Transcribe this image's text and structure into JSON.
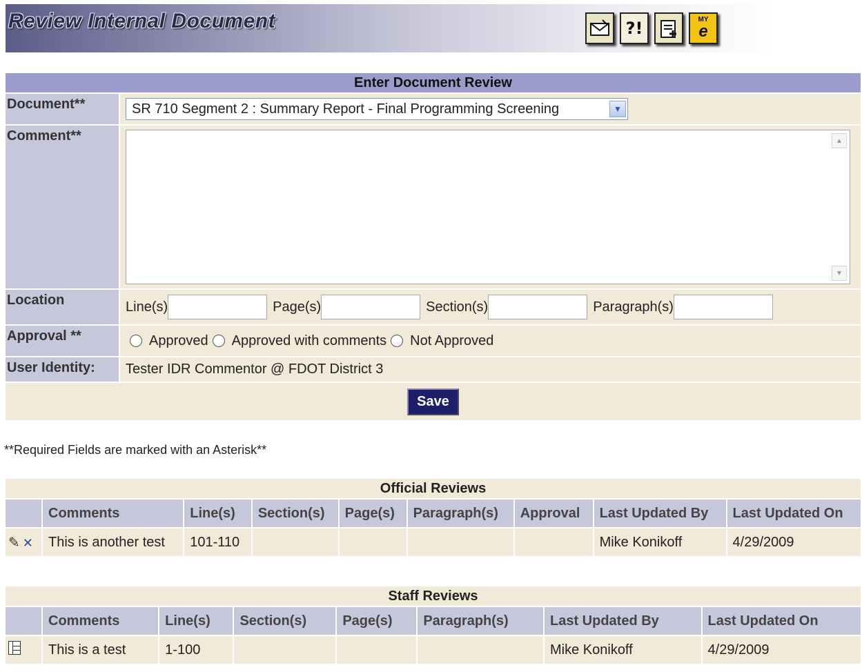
{
  "header": {
    "title": "Review Internal Document",
    "toolbar": [
      {
        "icon": "mail-icon"
      },
      {
        "icon": "help-icon",
        "glyph": "?!"
      },
      {
        "icon": "add-document-icon"
      },
      {
        "icon": "my-e-icon",
        "top": "MY",
        "bottom": "e"
      }
    ]
  },
  "form": {
    "section_title": "Enter Document Review",
    "document_label": "Document**",
    "document_value": "SR 710 Segment 2 : Summary Report - Final Programming Screening",
    "comment_label": "Comment**",
    "comment_value": "",
    "location_label": "Location",
    "line_label": "Line(s)",
    "page_label": "Page(s)",
    "section_label": "Section(s)",
    "paragraph_label": "Paragraph(s)",
    "approval_label": "Approval **",
    "approval_options": [
      "Approved",
      "Approved with comments",
      "Not Approved"
    ],
    "user_identity_label": "User Identity:",
    "user_identity_value": "Tester IDR Commentor @ FDOT District 3",
    "save_label": "Save"
  },
  "required_note": "**Required Fields are marked with an Asterisk**",
  "official_reviews": {
    "title": "Official Reviews",
    "columns": [
      "Comments",
      "Line(s)",
      "Section(s)",
      "Page(s)",
      "Paragraph(s)",
      "Approval",
      "Last Updated By",
      "Last Updated On"
    ],
    "rows": [
      {
        "comments": "This is another test",
        "lines": "101-110",
        "sections": "",
        "pages": "",
        "paragraphs": "",
        "approval": "",
        "updated_by": "Mike Konikoff",
        "updated_on": "4/29/2009"
      }
    ]
  },
  "staff_reviews": {
    "title": "Staff Reviews",
    "columns": [
      "Comments",
      "Line(s)",
      "Section(s)",
      "Page(s)",
      "Paragraph(s)",
      "Last Updated By",
      "Last Updated On"
    ],
    "rows": [
      {
        "comments": "This is a test",
        "lines": "1-100",
        "sections": "",
        "pages": "",
        "paragraphs": "",
        "updated_by": "Mike Konikoff",
        "updated_on": "4/29/2009"
      }
    ]
  }
}
